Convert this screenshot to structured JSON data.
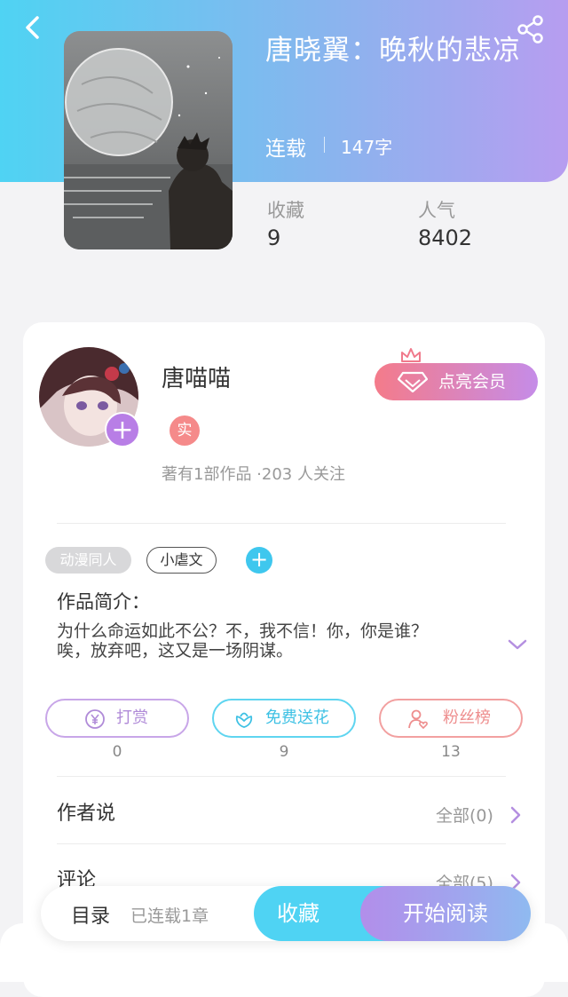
{
  "header": {
    "back_icon": "chevron-left-icon",
    "share_icon": "share-icon",
    "book_title": "唐晓翼：晚秋的悲凉",
    "status": "连载",
    "word_count": "147字",
    "stats": [
      {
        "label": "收藏",
        "value": "9"
      },
      {
        "label": "人气",
        "value": "8402"
      }
    ]
  },
  "author": {
    "name": "唐喵喵",
    "verified_badge": "实",
    "stats": "著有1部作品 ·203 人关注",
    "vip_button": "点亮会员"
  },
  "tags": [
    "动漫同人",
    "小虐文"
  ],
  "intro": {
    "title": "作品简介：",
    "lines": [
      "为什么命运如此不公？不，我不信！你，你是谁？",
      "唉，放弃吧，这又是一场阴谋。"
    ]
  },
  "actions": [
    {
      "label": "打赏",
      "count": "0",
      "icon": "yen-coin-icon"
    },
    {
      "label": "免费送花",
      "count": "9",
      "icon": "flower-icon"
    },
    {
      "label": "粉丝榜",
      "count": "13",
      "icon": "user-heart-icon"
    }
  ],
  "sections": [
    {
      "title": "作者说",
      "right": "全部(0)"
    },
    {
      "title": "评论",
      "right": "全部(5)"
    }
  ],
  "bottom_bar": {
    "toc": "目录",
    "chapters": "已连载1章",
    "collect": "收藏",
    "read": "开始阅读"
  },
  "colors": {
    "header_gradient_start": "#4fd3f3",
    "header_gradient_end": "#b79df0",
    "accent_cyan": "#4fd3f3",
    "accent_purple": "#b28eea"
  }
}
